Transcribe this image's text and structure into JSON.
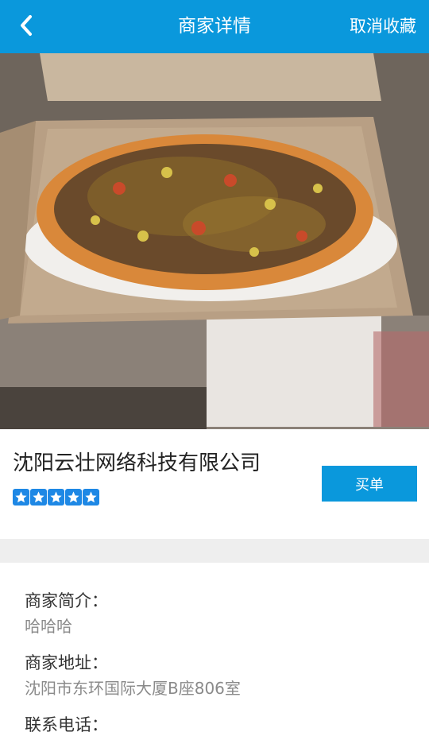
{
  "header": {
    "title": "商家详情",
    "right_action": "取消收藏"
  },
  "merchant": {
    "name": "沈阳云壮网络科技有限公司",
    "rating": 5,
    "buy_label": "买单"
  },
  "details": {
    "intro_label": "商家简介：",
    "intro_value": "哈哈哈",
    "address_label": "商家地址：",
    "address_value": "沈阳市东环国际大厦B座806室",
    "phone_label": "联系电话："
  },
  "colors": {
    "primary": "#0a98dc",
    "star": "#1e88e5"
  }
}
